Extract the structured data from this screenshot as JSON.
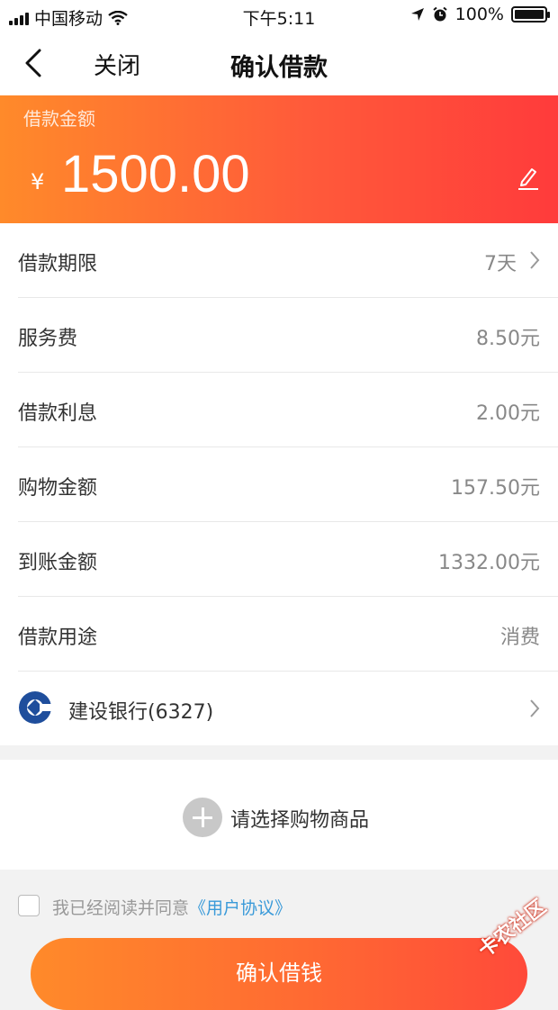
{
  "status_bar": {
    "carrier": "中国移动",
    "time": "下午5:11",
    "battery": "100%",
    "battery_level": 1.0
  },
  "nav": {
    "close_label": "关闭",
    "title": "确认借款"
  },
  "hero": {
    "label": "借款金额",
    "currency": "¥",
    "amount": "1500.00"
  },
  "details": [
    {
      "key": "借款期限",
      "value": "7天"
    },
    {
      "key": "服务费",
      "value": "8.50元"
    },
    {
      "key": "借款利息",
      "value": "2.00元"
    },
    {
      "key": "购物金额",
      "value": "157.50元"
    },
    {
      "key": "到账金额",
      "value": "1332.00元"
    },
    {
      "key": "借款用途",
      "value": "消费"
    }
  ],
  "bank": {
    "name": "建设银行(6327)",
    "icon": "ccb-bank-logo-icon"
  },
  "shopping": {
    "label": "请选择购物商品"
  },
  "agreement": {
    "text": "我已经阅读并同意",
    "link": "《用户协议》"
  },
  "submit_label": "确认借钱",
  "watermark": "卡农社区",
  "colors": {
    "accent_start": "#ff8a2a",
    "accent_end": "#ff3b3b",
    "link": "#3a9ad9"
  }
}
